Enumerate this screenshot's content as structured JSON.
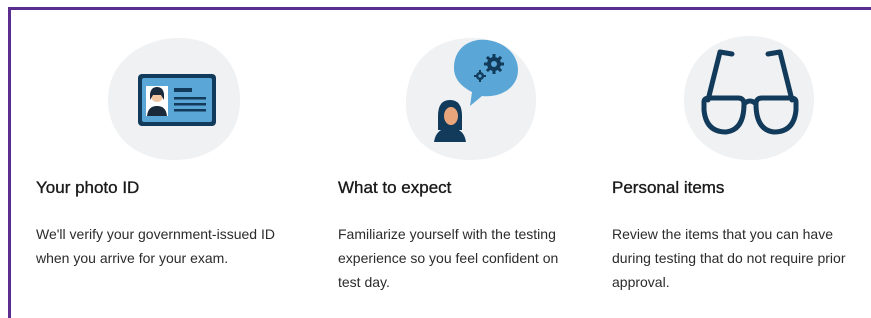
{
  "colors": {
    "frame_border": "#5b2d8e",
    "icon_blob": "#f0f1f3",
    "icon_blue": "#5aa6d6",
    "icon_navy": "#123a5a"
  },
  "cards": [
    {
      "icon": "photo-id-card-icon",
      "title": "Your photo ID",
      "body": "We'll verify your government-issued ID when you arrive for your exam."
    },
    {
      "icon": "speech-bubble-gears-icon",
      "title": "What to expect",
      "body": "Familiarize yourself with the testing experience so you feel confident on test day."
    },
    {
      "icon": "glasses-icon",
      "title": "Personal items",
      "body": "Review the items that you can have during testing that do not require prior approval."
    }
  ]
}
